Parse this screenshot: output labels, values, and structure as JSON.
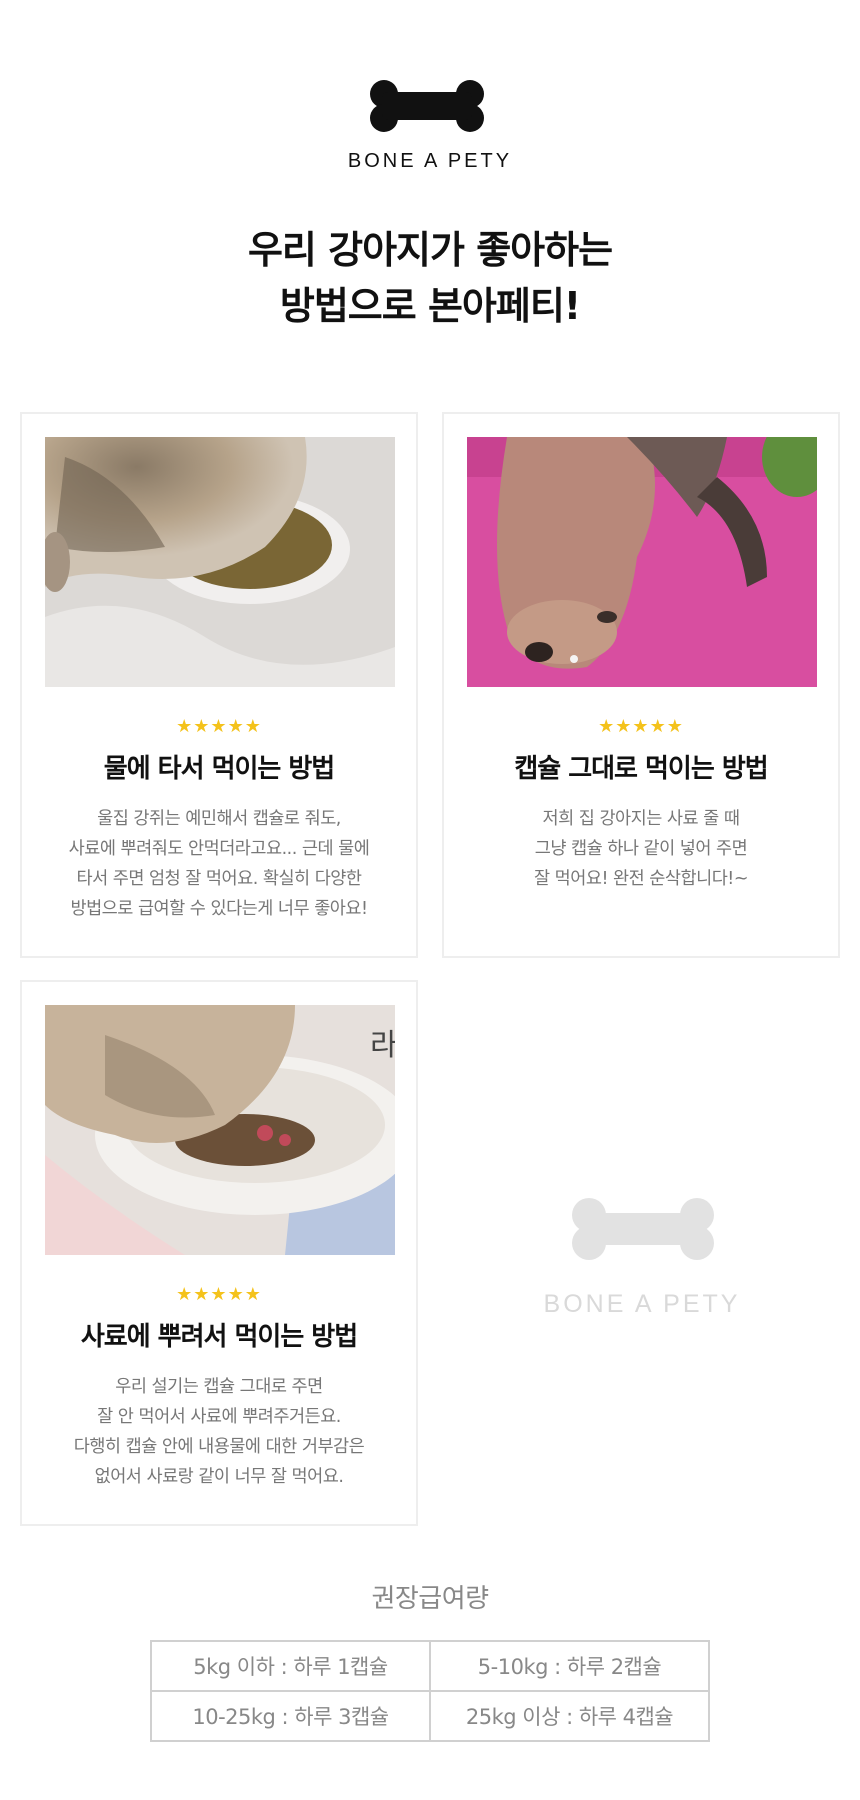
{
  "header": {
    "brand": "BONE A PETY",
    "headline_line1": "우리 강아지가 좋아하는",
    "headline_line2": "방법으로 본아페티!"
  },
  "cards": [
    {
      "stars": "★★★★★",
      "title": "물에 타서 먹이는 방법",
      "desc": [
        "울집 강쥐는 예민해서 캡슐로 줘도,",
        "사료에 뿌려줘도 안먹더라고요... 근데 물에",
        "타서 주면 엄청 잘 먹어요. 확실히 다양한",
        "방법으로 급여할 수 있다는게 너무 좋아요!"
      ]
    },
    {
      "stars": "★★★★★",
      "title": "캡슐 그대로 먹이는 방법",
      "desc": [
        "저희 집 강아지는 사료 줄 때",
        "그냥 캡슐 하나 같이 넣어 주면",
        "잘 먹어요! 완전 순삭합니다!~"
      ]
    },
    {
      "stars": "★★★★★",
      "title": "사료에 뿌려서 먹이는 방법",
      "desc": [
        "우리 설기는 캡슐 그대로 주면",
        "잘 안 먹어서 사료에 뿌려주거든요.",
        "다행히 캡슐 안에 내용물에 대한 거부감은",
        "없어서 사료랑 같이 너무 잘 먹어요."
      ]
    }
  ],
  "placeholder": {
    "brand": "BONE A PETY"
  },
  "recommendation": {
    "title": "권장급여량",
    "rows": [
      [
        "5kg 이하 : 하루 1캡슐",
        "5-10kg : 하루 2캡슐"
      ],
      [
        "10-25kg : 하루 3캡슐",
        "25kg 이상 : 하루 4캡슐"
      ]
    ]
  },
  "colors": {
    "star": "#f4c21b",
    "bone_dark": "#111111",
    "bone_light": "#e2e2e2",
    "photo2_bg": "#d84ea0"
  },
  "icons": {
    "logo": "bone-icon",
    "rating": "star-icon"
  }
}
